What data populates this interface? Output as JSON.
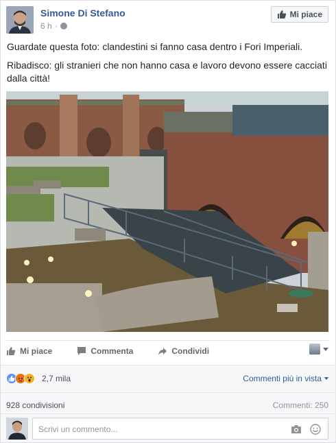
{
  "post": {
    "author": "Simone Di Stefano",
    "time": "6 h",
    "like_page_label": "Mi piace",
    "text_line1": "Guardate questa foto: clandestini si fanno casa dentro i Fori Imperiali.",
    "text_line2": "Ribadisco: gli stranieri che non hanno casa e lavoro devono essere cacciati dalla città!"
  },
  "actions": {
    "like": "Mi piace",
    "comment": "Commenta",
    "share": "Condividi"
  },
  "reactions": {
    "count": "2,7 mila",
    "sort_label": "Commenti più in vista"
  },
  "stats": {
    "shares": "928 condivisioni",
    "comments": "Commenti: 250"
  },
  "comment_input": {
    "placeholder": "Scrivi un commento..."
  },
  "icons": {
    "globe": "globe-icon",
    "thumb": "thumbs-up-icon",
    "comment": "comment-icon",
    "share": "share-arrow-icon",
    "camera": "camera-icon",
    "emoji": "emoji-icon"
  },
  "colors": {
    "link": "#365899",
    "like_blue": "#5890ff",
    "angry": "#e9710f",
    "wow": "#f7b125"
  }
}
